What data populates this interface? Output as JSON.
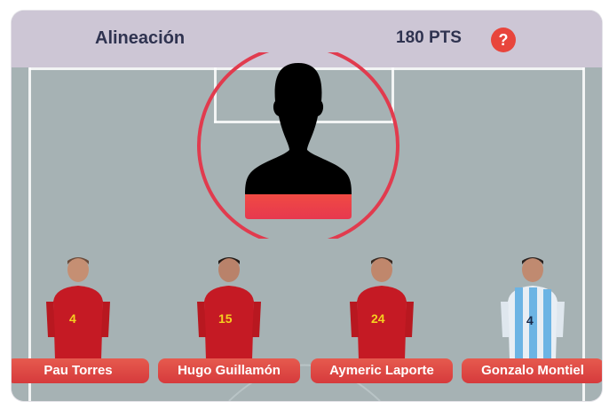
{
  "header": {
    "title": "Alineación",
    "points": "180 PTS",
    "help_glyph": "?"
  },
  "colors": {
    "header_bg": "#cdc6d5",
    "pitch_bg": "#a6b2b4",
    "accent_red": "#e2394a",
    "text_dark": "#2f3350"
  },
  "empty_slot": {
    "icon": "player-silhouette-icon"
  },
  "players": [
    {
      "name": "Pau Torres",
      "number": "4",
      "kit": "spain"
    },
    {
      "name": "Hugo Guillamón",
      "number": "15",
      "kit": "spain"
    },
    {
      "name": "Aymeric Laporte",
      "number": "24",
      "kit": "spain"
    },
    {
      "name": "Gonzalo Montiel",
      "number": "4",
      "kit": "argentina"
    }
  ]
}
